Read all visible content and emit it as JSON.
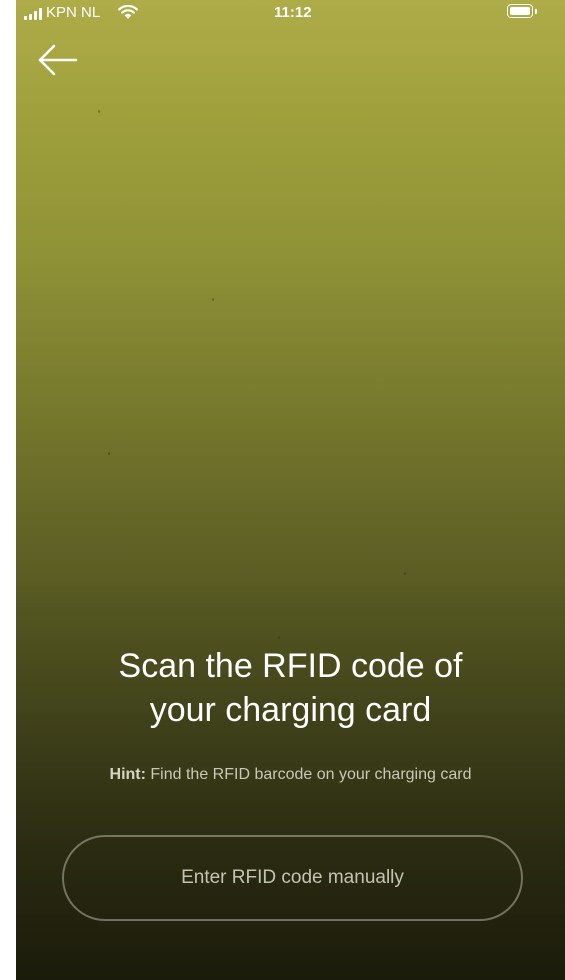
{
  "status_bar": {
    "carrier": "KPN NL",
    "time": "11:12",
    "signal_icon": "cellular-signal-icon",
    "wifi_icon": "wifi-icon",
    "battery_icon": "battery-icon",
    "battery_level": 1.0
  },
  "navigation": {
    "back_icon": "arrow-left-icon"
  },
  "scanner": {
    "title_line1": "Scan the RFID code of",
    "title_line2": "your charging card",
    "hint_label": "Hint:",
    "hint_text": "Find the RFID barcode on your charging card",
    "manual_button_label": "Enter RFID code manually"
  },
  "colors": {
    "camera_top": "#aeac48",
    "camera_bottom": "#1b1b0b",
    "text_primary": "#ffffff",
    "button_border": "#d2d2c3"
  }
}
